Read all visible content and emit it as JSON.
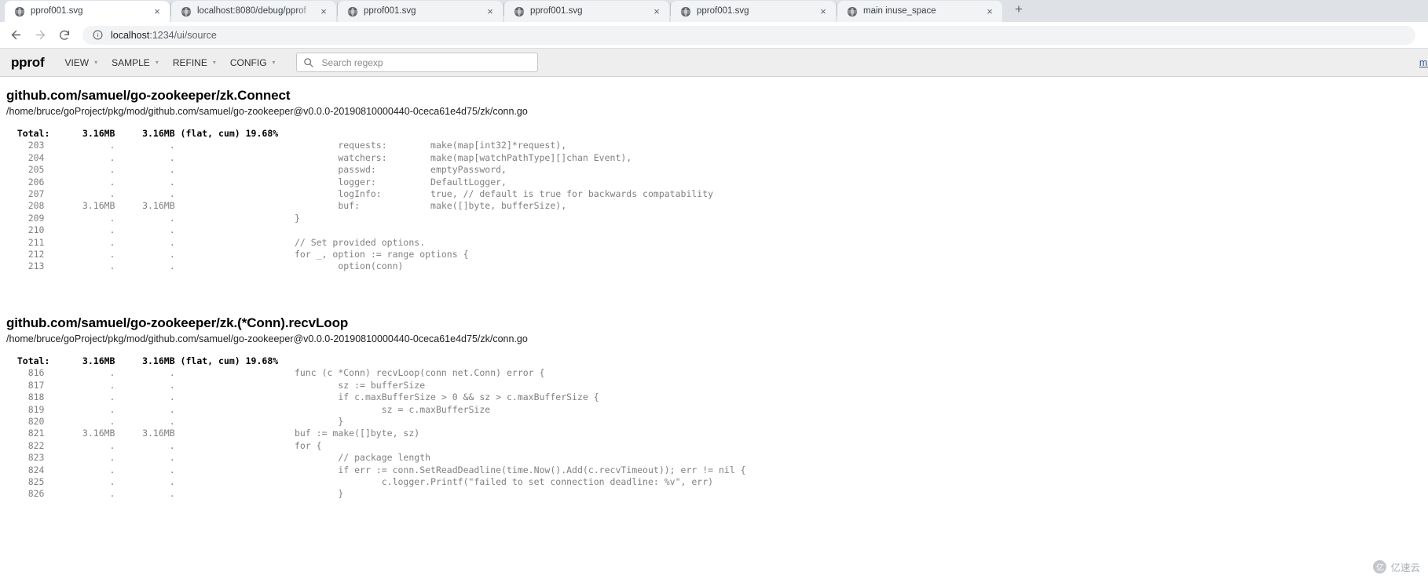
{
  "browser": {
    "tabs": [
      {
        "title": "pprof001.svg",
        "icon": "globe-icon",
        "active": true,
        "close": "×"
      },
      {
        "title": "localhost:8080/debug/pprof",
        "icon": "globe-icon",
        "active": false,
        "close": "×"
      },
      {
        "title": "pprof001.svg",
        "icon": "globe-icon",
        "active": false,
        "close": "×"
      },
      {
        "title": "pprof001.svg",
        "icon": "globe-icon",
        "active": false,
        "close": "×"
      },
      {
        "title": "pprof001.svg",
        "icon": "globe-icon",
        "active": false,
        "close": "×"
      },
      {
        "title": "main inuse_space",
        "icon": "globe-icon",
        "active": false,
        "close": "×"
      }
    ],
    "new_tab_label": "+",
    "nav": {
      "back": "←",
      "forward": "→",
      "reload": "↻"
    },
    "omnibox": {
      "info_icon": "ⓘ",
      "host": "localhost",
      "path": ":1234/ui/source",
      "full_url": "localhost:1234/ui/source"
    }
  },
  "pprof": {
    "brand": "pprof",
    "menus": [
      {
        "label": "VIEW",
        "caret": "▾"
      },
      {
        "label": "SAMPLE",
        "caret": "▾"
      },
      {
        "label": "REFINE",
        "caret": "▾"
      },
      {
        "label": "CONFIG",
        "caret": "▾"
      }
    ],
    "search": {
      "icon": "search-icon",
      "placeholder": "Search regexp",
      "value": ""
    },
    "right_link": "main"
  },
  "sections": [
    {
      "title": "github.com/samuel/go-zookeeper/zk.Connect",
      "path": "/home/bruce/goProject/pkg/mod/github.com/samuel/go-zookeeper@v0.0.0-20190810000440-0ceca61e4d75/zk/conn.go",
      "total_line": "  Total:      3.16MB     3.16MB (flat, cum) 19.68%",
      "code": "    203            .          .                              requests:        make(map[int32]*request),\n    204            .          .                              watchers:        make(map[watchPathType][]chan Event),\n    205            .          .                              passwd:          emptyPassword,\n    206            .          .                              logger:          DefaultLogger,\n    207            .          .                              logInfo:         true, // default is true for backwards compatability\n    208       3.16MB     3.16MB                              buf:             make([]byte, bufferSize),\n    209            .          .                      }\n    210            .          .\n    211            .          .                      // Set provided options.\n    212            .          .                      for _, option := range options {\n    213            .          .                              option(conn)"
    },
    {
      "title": "github.com/samuel/go-zookeeper/zk.(*Conn).recvLoop",
      "path": "/home/bruce/goProject/pkg/mod/github.com/samuel/go-zookeeper@v0.0.0-20190810000440-0ceca61e4d75/zk/conn.go",
      "total_line": "  Total:      3.16MB     3.16MB (flat, cum) 19.68%",
      "code": "    816            .          .                      func (c *Conn) recvLoop(conn net.Conn) error {\n    817            .          .                              sz := bufferSize\n    818            .          .                              if c.maxBufferSize > 0 && sz > c.maxBufferSize {\n    819            .          .                                      sz = c.maxBufferSize\n    820            .          .                              }\n    821       3.16MB     3.16MB                      buf := make([]byte, sz)\n    822            .          .                      for {\n    823            .          .                              // package length\n    824            .          .                              if err := conn.SetReadDeadline(time.Now().Add(c.recvTimeout)); err != nil {\n    825            .          .                                      c.logger.Printf(\"failed to set connection deadline: %v\", err)\n    826            .          .                              }"
    }
  ],
  "watermark": {
    "logo": "亿",
    "text": "亿速云"
  },
  "colors": {
    "chrome_tabstrip": "#dee1e6",
    "pprof_header": "#eeeeee",
    "link": "#3b5998",
    "code_gray": "#808080"
  }
}
